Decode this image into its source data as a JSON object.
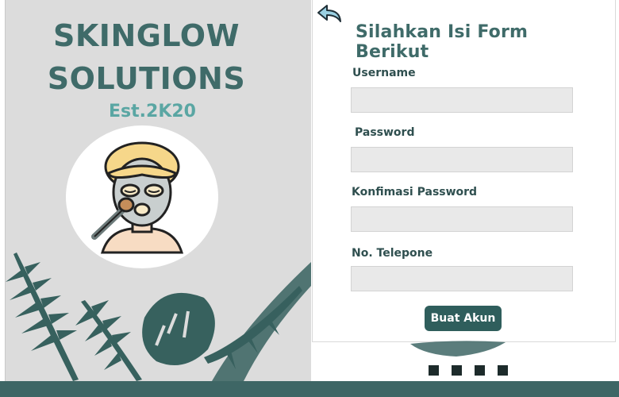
{
  "brand": {
    "title_line1": "SKINGLOW",
    "title_line2": "SOLUTIONS",
    "established": "Est.2K20"
  },
  "form": {
    "title": "Silahkan Isi Form Berikut",
    "fields": [
      {
        "label": "Username",
        "value": "",
        "placeholder": ""
      },
      {
        "label": "Password",
        "value": "",
        "placeholder": ""
      },
      {
        "label": "Konfimasi Password",
        "value": "",
        "placeholder": ""
      },
      {
        "label": "No. Telepone",
        "value": "",
        "placeholder": ""
      }
    ],
    "submit_label": "Buat Akun"
  },
  "icons": {
    "back": "back-arrow-icon",
    "mascot": "face-mask-avatar-icon"
  },
  "colors": {
    "brand": "#3f6b69",
    "accent": "#5aa6a3",
    "button": "#2f5e5c",
    "panel": "#dcdcdc",
    "bottom_bar": "#3e6665"
  }
}
